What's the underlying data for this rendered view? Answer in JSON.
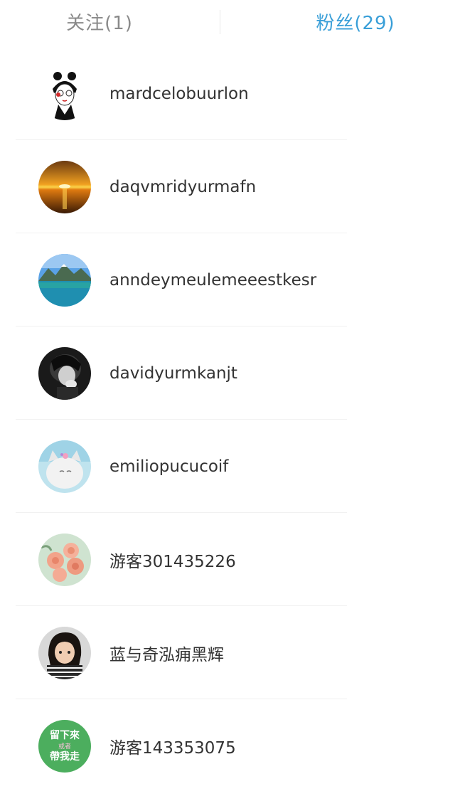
{
  "tabs": {
    "following_label": "关注(1)",
    "followers_label": "粉丝(29)",
    "inactive_color": "#8a8a8a",
    "active_color": "#3a9fd8"
  },
  "followers": [
    {
      "username": "mardcelobuurlon",
      "avatar": "cartoon-woman-with-glasses-avatar"
    },
    {
      "username": "daqvmridyurmafn",
      "avatar": "sunset-sea-avatar"
    },
    {
      "username": "anndeymeulemeeestkesr",
      "avatar": "mountain-lake-avatar"
    },
    {
      "username": "davidyurmkanjt",
      "avatar": "black-white-portrait-avatar"
    },
    {
      "username": "emiliopucucoif",
      "avatar": "white-cat-avatar"
    },
    {
      "username": "游客301435226",
      "avatar": "pink-roses-avatar"
    },
    {
      "username": "蓝与奇泓痈黑辉",
      "avatar": "child-photo-avatar"
    },
    {
      "username": "游客143353075",
      "avatar": "green-text-badge-avatar",
      "badge_text": [
        "留下來",
        "或者",
        "帶我走"
      ]
    }
  ]
}
